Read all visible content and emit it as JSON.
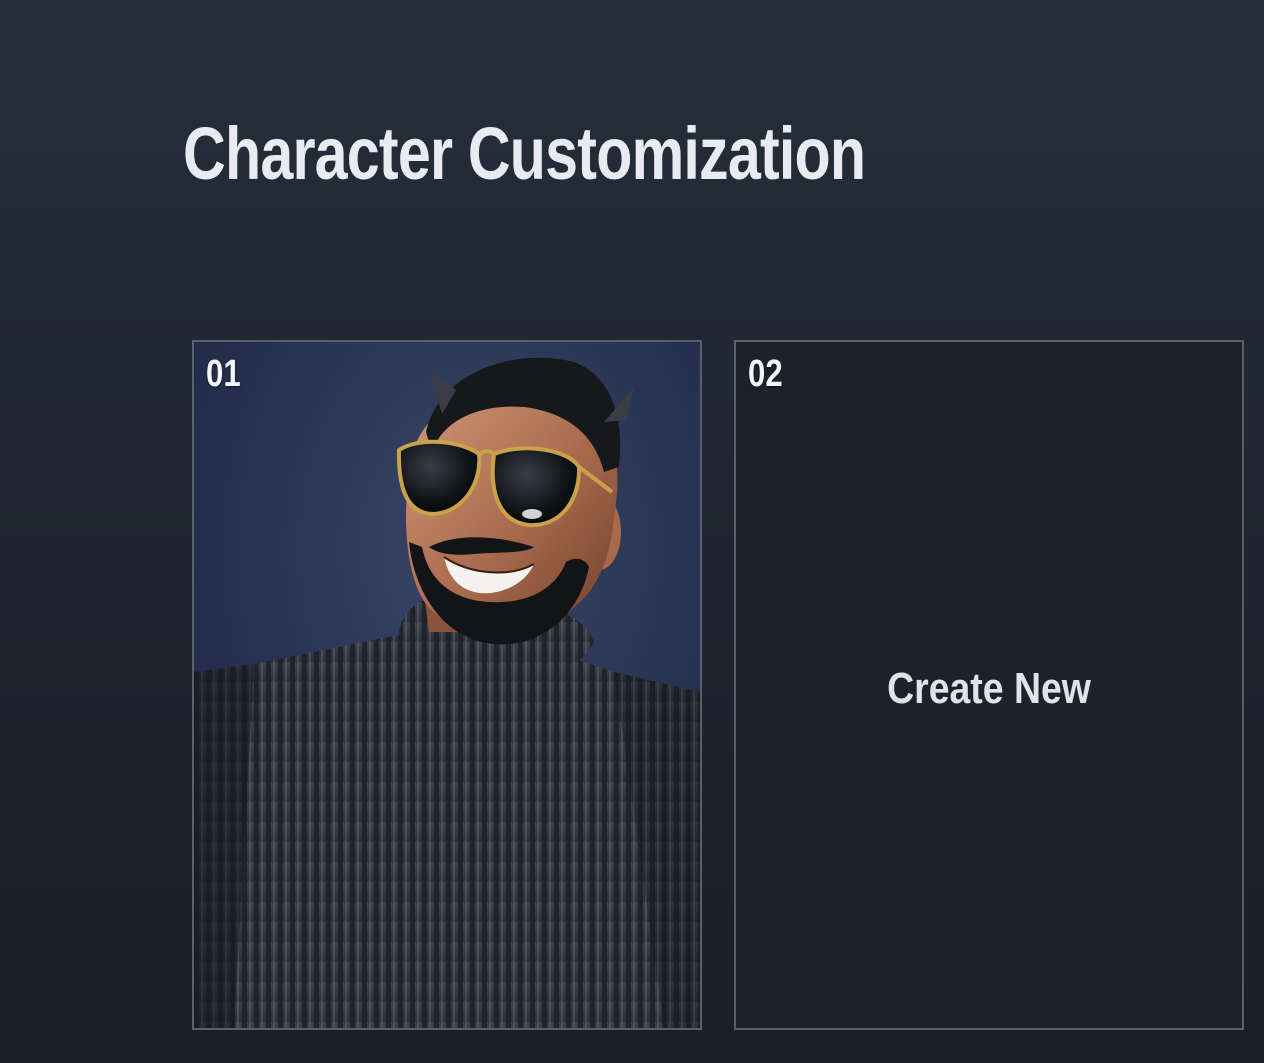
{
  "page": {
    "title": "Character Customization"
  },
  "slots": [
    {
      "number": "01",
      "content": "character-portrait"
    },
    {
      "number": "02",
      "action_label": "Create New"
    }
  ],
  "colors": {
    "background_top": "#252e3b",
    "background_bottom": "#1a1f28",
    "slot_border": "#5a6069",
    "title_text": "#e9ebf3",
    "empty_slot_fill": "#1c212b"
  }
}
